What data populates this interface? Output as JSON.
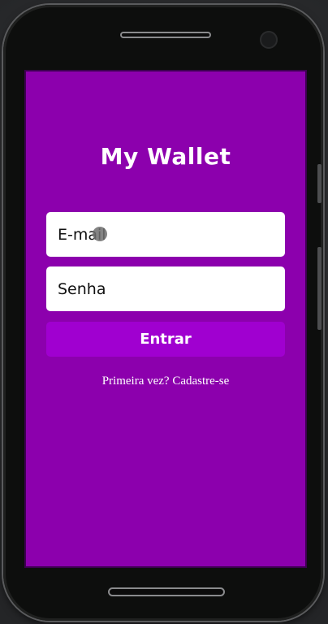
{
  "app": {
    "title": "My Wallet"
  },
  "login_form": {
    "email_placeholder": "E-mail",
    "password_placeholder": "Senha",
    "submit_label": "Entrar",
    "signup_link": "Primeira vez? Cadastre-se"
  },
  "colors": {
    "screen_background": "#8c00ad",
    "button_background": "#a000d0",
    "input_background": "#ffffff",
    "text_on_purple": "#ffffff"
  },
  "device": {
    "frame": "android-phone-frame"
  }
}
